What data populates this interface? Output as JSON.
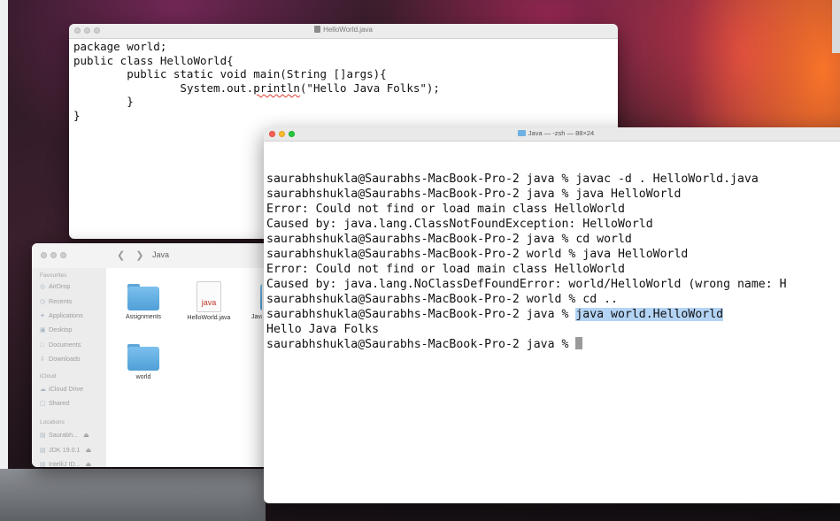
{
  "editor": {
    "title": "HelloWorld.java",
    "lines": [
      "package world;",
      "public class HelloWorld{",
      "        public static void main(String []args){",
      "                ",
      "        }",
      "}"
    ],
    "squiggle_prefix": "System.out.",
    "squiggle_word": "println",
    "squiggle_suffix": "(\"Hello Java Folks\");"
  },
  "finder": {
    "title": "Java",
    "sidebar": {
      "favourites_heading": "Favourites",
      "favourites": [
        "AirDrop",
        "Recents",
        "Applications",
        "Desktop",
        "Documents",
        "Downloads"
      ],
      "icloud_heading": "iCloud",
      "icloud": [
        "iCloud Drive",
        "Shared"
      ],
      "locations_heading": "Locations",
      "locations": [
        "Saurabh...",
        "JDK 19.0.1",
        "IntelliJ ID..."
      ]
    },
    "files": [
      {
        "name": "Assignments",
        "kind": "folder"
      },
      {
        "name": "HelloWorld.java",
        "kind": "java",
        "icon_text": "java"
      },
      {
        "name": "Java",
        "kind": "partial"
      },
      {
        "name": "world",
        "kind": "folder"
      }
    ]
  },
  "terminal": {
    "title": "Java — -zsh — 88×24",
    "lines": [
      "saurabhshukla@Saurabhs-MacBook-Pro-2 java % javac -d . HelloWorld.java",
      "saurabhshukla@Saurabhs-MacBook-Pro-2 java % java HelloWorld",
      "Error: Could not find or load main class HelloWorld",
      "Caused by: java.lang.ClassNotFoundException: HelloWorld",
      "saurabhshukla@Saurabhs-MacBook-Pro-2 java % cd world",
      "saurabhshukla@Saurabhs-MacBook-Pro-2 world % java HelloWorld",
      "Error: Could not find or load main class HelloWorld",
      "Caused by: java.lang.NoClassDefFoundError: world/HelloWorld (wrong name: H",
      "saurabhshukla@Saurabhs-MacBook-Pro-2 world % cd .."
    ],
    "prompt_before_highlight": "saurabhshukla@Saurabhs-MacBook-Pro-2 java % ",
    "highlighted_command": "java world.HelloWorld",
    "output_line": "Hello Java Folks",
    "final_prompt": "saurabhshukla@Saurabhs-MacBook-Pro-2 java % "
  },
  "colors": {
    "selection_highlight": "#b4d4f5",
    "close": "#ff5f57",
    "minimize": "#febc2e",
    "zoom": "#28c840",
    "folder": "#5ea6d8"
  }
}
